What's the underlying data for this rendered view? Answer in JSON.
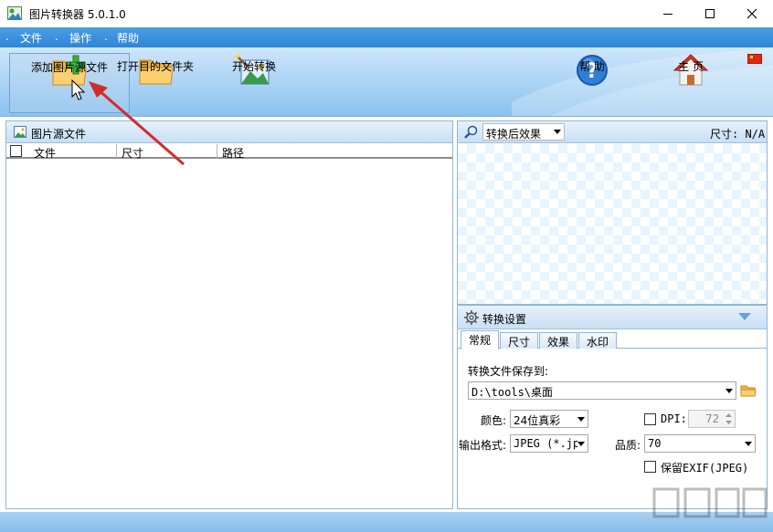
{
  "window": {
    "title": "图片转换器 5.0.1.0"
  },
  "menu": {
    "items": [
      "文件",
      "操作",
      "帮助"
    ]
  },
  "toolbar": {
    "add_source": "添加图片源文件",
    "open_target": "打开目的文件夹",
    "start_convert": "开始转换",
    "help": "帮 助",
    "home": "主 页"
  },
  "source_panel": {
    "title": "图片源文件",
    "columns": [
      "文件",
      "尺寸",
      "路径"
    ]
  },
  "preview_panel": {
    "effect_dropdown": "转换后效果",
    "size_label": "尺寸: N/A"
  },
  "settings_panel": {
    "title": "转换设置",
    "tabs": [
      "常规",
      "尺寸",
      "效果",
      "水印"
    ],
    "selected_tab": "常规",
    "save_to_label": "转换文件保存到:",
    "save_to_value": "D:\\tools\\桌面",
    "color_label": "颜色:",
    "color_value": "24位真彩",
    "dpi_label": "DPI:",
    "dpi_value": "72",
    "format_label": "输出格式:",
    "format_value": "JPEG (*.jpg)",
    "quality_label": "品质:",
    "quality_value": "70",
    "exif_label": "保留EXIF(JPEG)"
  },
  "colors": {
    "menubar": "#3a8fdc",
    "toolbar": "#a9d2f4",
    "arrow": "#d42a2a"
  }
}
